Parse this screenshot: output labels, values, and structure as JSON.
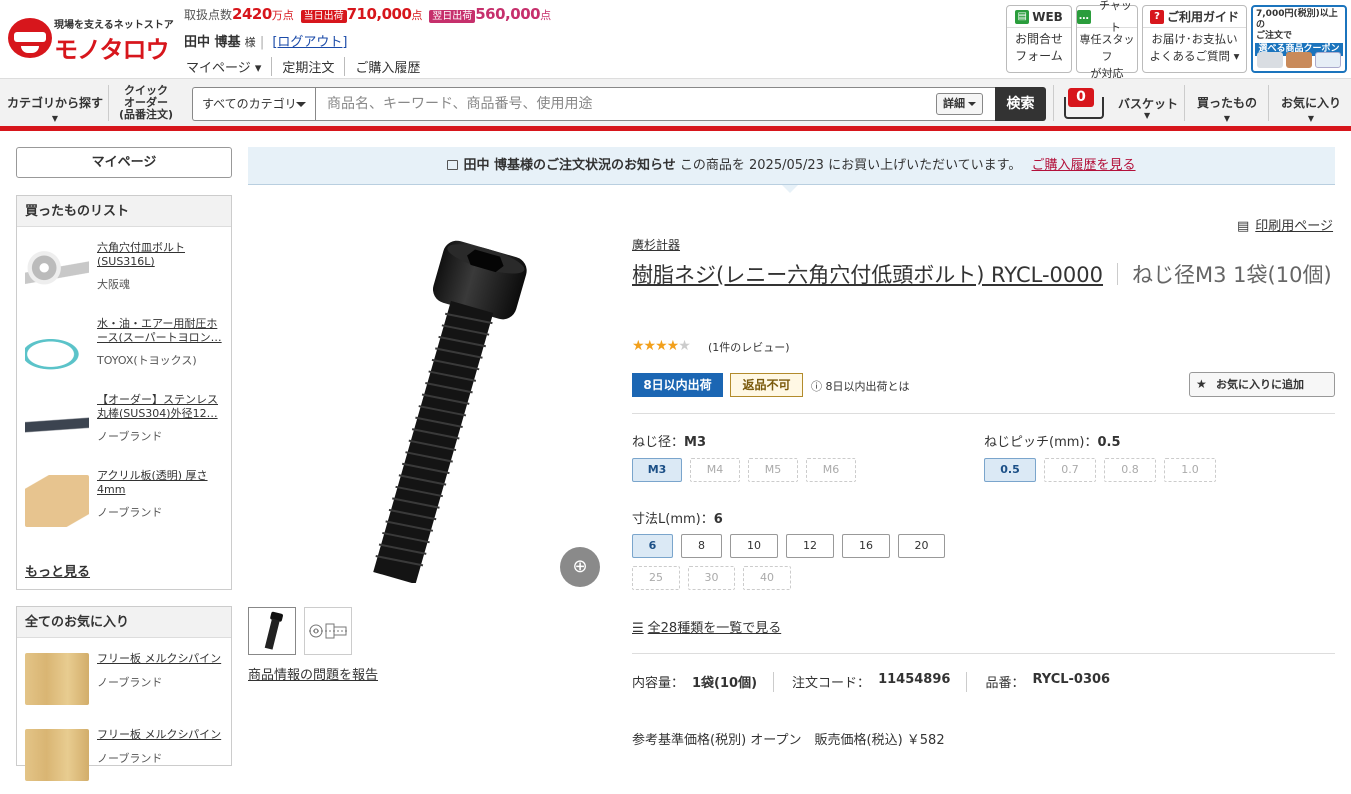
{
  "header": {
    "logo_tagline": "現場を支えるネットストア",
    "logo_name": "モノタロウ",
    "points_label": "取扱点数",
    "points_total": "2420",
    "points_total_unit": "万点",
    "same_day_badge": "当日出荷",
    "same_day_count": "710,000",
    "same_day_unit": "点",
    "next_day_badge": "翌日出荷",
    "next_day_count": "560,000",
    "next_day_unit": "点",
    "user_name": "田中 博基",
    "user_suffix": "様",
    "logout": "[ログアウト]",
    "nav": [
      "マイページ ▾",
      "定期注文",
      "ご購入履歴"
    ],
    "web_title": "WEB",
    "web_body_1": "お問合せ",
    "web_body_2": "フォーム",
    "chat_title": "チャット",
    "chat_body_1": "専任スタッフ",
    "chat_body_2": "が対応",
    "guide_title": "ご利用ガイド",
    "guide_body_1": "お届け･お支払い",
    "guide_body_2": "よくあるご質問 ▾",
    "coupon_line1": "7,000円(税別)以上の",
    "coupon_line2": "ご注文で",
    "coupon_line3": "選べる商品クーポン"
  },
  "searchbar": {
    "category_browse": "カテゴリから探す",
    "quick_order_1": "クイック",
    "quick_order_2": "オーダー",
    "quick_order_3": "(品番注文)",
    "category_select": "すべてのカテゴリ",
    "placeholder": "商品名、キーワード、商品番号、使用用途",
    "detail": "詳細",
    "search": "検索",
    "cart_count": "0",
    "cart_label": "バスケット",
    "bought_label": "買ったもの",
    "fav_label": "お気に入り"
  },
  "sidebar": {
    "mypage": "マイページ",
    "bought_title": "買ったものリスト",
    "bought_items": [
      {
        "name": "六角穴付皿ボルト (SUS316L)",
        "brand": "大阪魂"
      },
      {
        "name": "水・油・エアー用耐圧ホース(スーパートヨロン…",
        "brand": "TOYOX(トヨックス)"
      },
      {
        "name": "【オーダー】ステンレス丸棒(SUS304)外径12…",
        "brand": "ノーブランド"
      },
      {
        "name": "アクリル板(透明) 厚さ4mm",
        "brand": "ノーブランド"
      }
    ],
    "more": "もっと見る",
    "fav_title": "全てのお気に入り",
    "fav_items": [
      {
        "name": "フリー板 メルクシパイン",
        "brand": "ノーブランド"
      },
      {
        "name": "フリー板 メルクシパイン",
        "brand": "ノーブランド"
      }
    ]
  },
  "notice": {
    "who": "田中 博基様のご注文状況のお知らせ",
    "text": "この商品を 2025/05/23 にお買い上げいただいています。",
    "link": "ご購入履歴を見る"
  },
  "gallery": {
    "report": "商品情報の問題を報告"
  },
  "product": {
    "print": "印刷用ページ",
    "brand": "廣杉計器",
    "title": "樹脂ネジ(レニー六角穴付低頭ボルト) RYCL-0000",
    "subtitle": "ねじ径M3 1袋(10個)",
    "rating": 4,
    "stars_on": "★★★★",
    "stars_off": "★",
    "reviews": "(1件のレビュー)",
    "ship_badge": "8日以内出荷",
    "return_badge": "返品不可",
    "ship_info": "ⓘ 8日以内出荷とは",
    "fav_button": "お気に入りに追加",
    "spec_diam_label": "ねじ径：",
    "spec_diam_value": "M3",
    "diam_options": [
      "M3",
      "M4",
      "M5",
      "M6"
    ],
    "spec_pitch_label": "ねじピッチ(mm)：",
    "spec_pitch_value": "0.5",
    "pitch_options": [
      "0.5",
      "0.7",
      "0.8",
      "1.0"
    ],
    "spec_len_label": "寸法L(mm)：",
    "spec_len_value": "6",
    "len_options": [
      "6",
      "8",
      "10",
      "12",
      "16",
      "20",
      "25",
      "30",
      "40"
    ],
    "view_all": "全28種類を一覧で見る",
    "qty_label": "内容量：",
    "qty_value": "1袋(10個)",
    "code_label": "注文コード：",
    "code_value": "11454896",
    "part_label": "品番：",
    "part_value": "RYCL-0306",
    "price_line": "参考基準価格(税別) オープン　販売価格(税込) ￥582"
  },
  "colors": {
    "brand_red": "#d7161c",
    "ship_blue": "#1b66b3",
    "notice_bg": "#e7f1f8",
    "link_red": "#b3103a"
  }
}
